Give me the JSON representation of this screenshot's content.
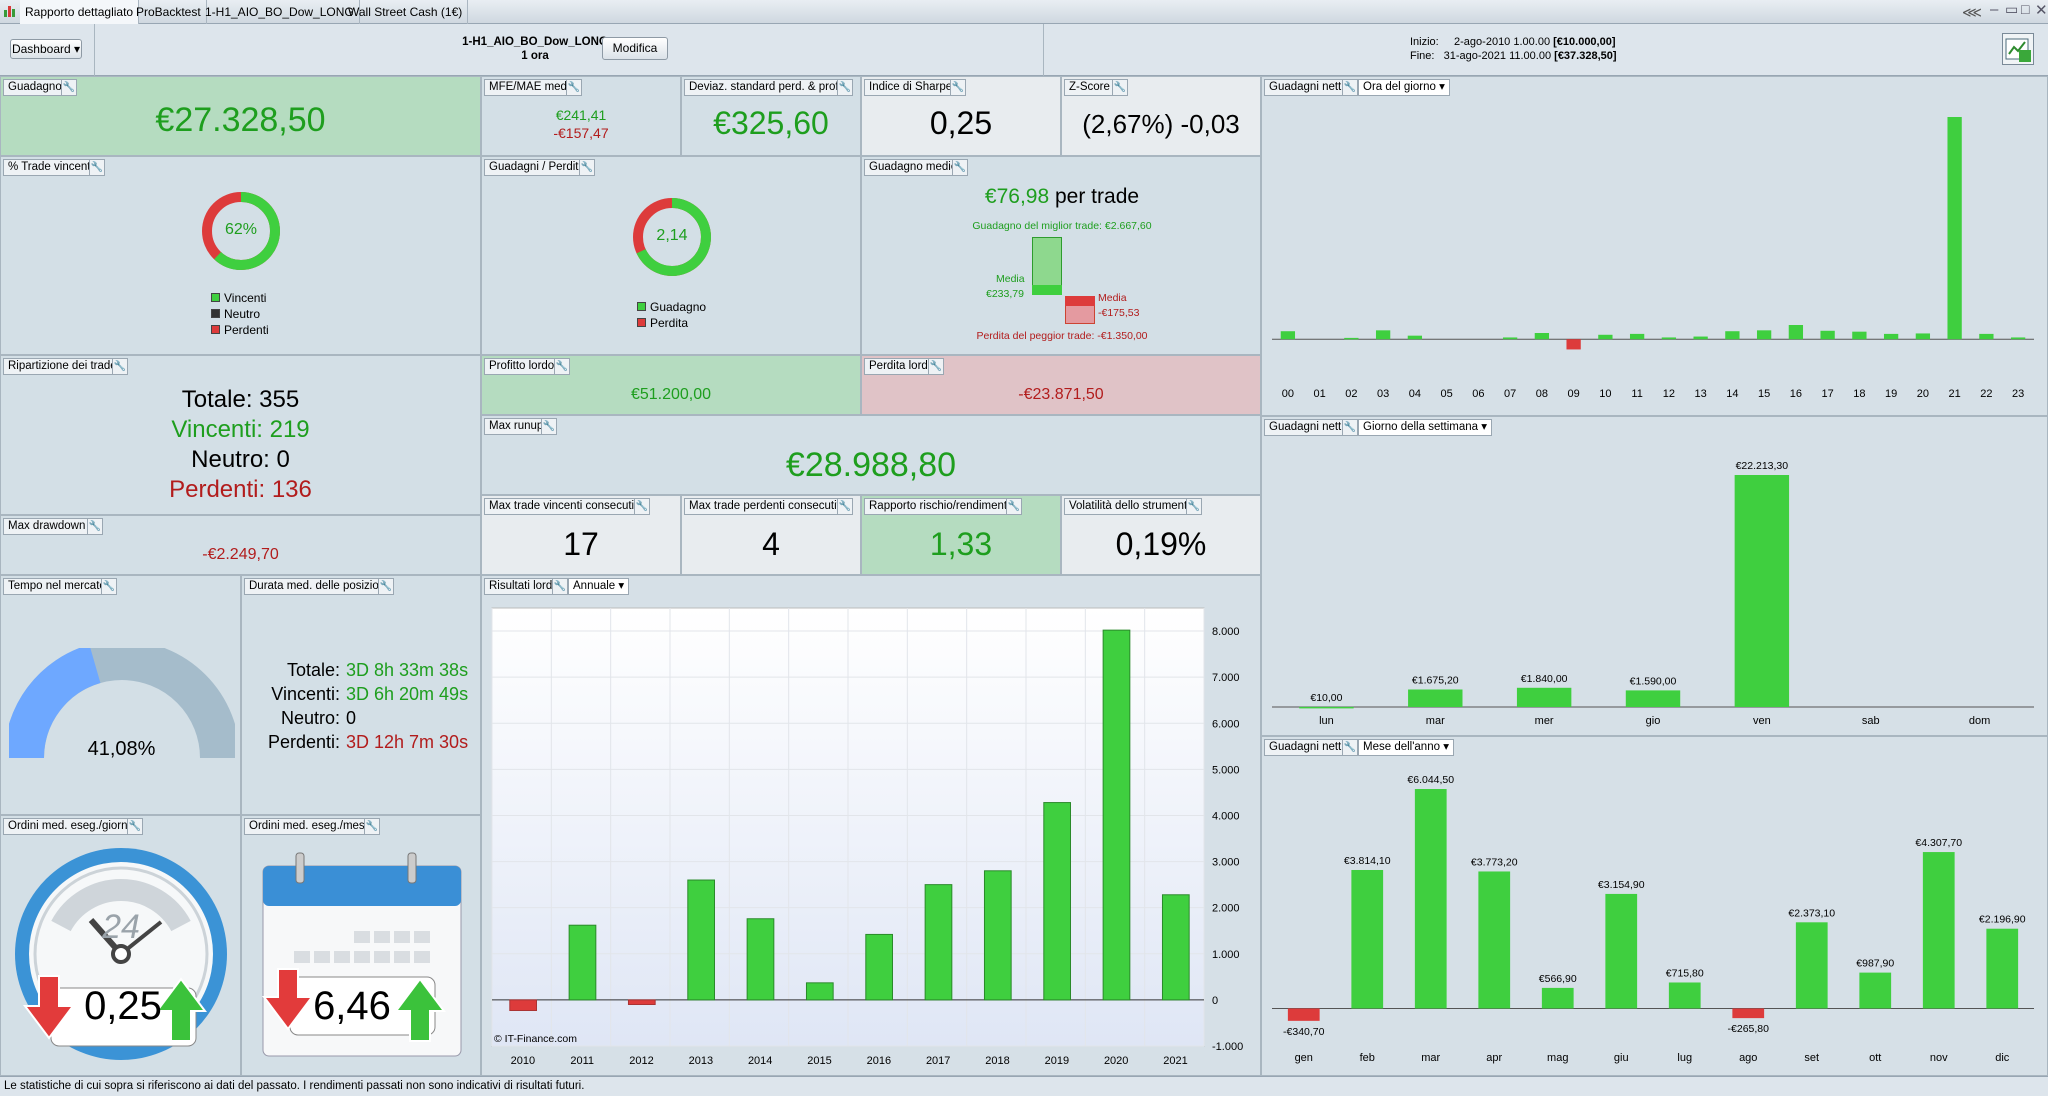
{
  "tabs": [
    "Rapporto dettagliato",
    "ProBacktest",
    "1-H1_AIO_BO_Dow_LONG",
    "Wall Street Cash (1€)"
  ],
  "header": {
    "dashboard_label": "Dashboard",
    "strategy_name": "1-H1_AIO_BO_Dow_LONG",
    "timeframe": "1 ora",
    "edit_label": "Modifica",
    "start_label": "Inizio:",
    "start_value": "2-ago-2010 1.00.00",
    "start_capital": "[€10.000,00]",
    "end_label": "Fine:",
    "end_value": "31-ago-2021 11.00.00",
    "end_capital": "[€37.328,50]"
  },
  "colors": {
    "green": "#3fcf3f",
    "red": "#dd3b3b",
    "text_green": "#1e9e1e",
    "text_red": "#b21c1c"
  },
  "icons": [
    "calendar-icon",
    "wrench-icon",
    "share-icon",
    "report-icon"
  ],
  "guadagno": {
    "title": "Guadagno",
    "value": "€27.328,50"
  },
  "mfe": {
    "title": "MFE/MAE medio",
    "mfe": "€241,41",
    "mae": "-€157,47"
  },
  "deviaz": {
    "title": "Deviaz. standard perd. & prof.",
    "value": "€325,60"
  },
  "sharpe": {
    "title": "Indice di Sharpe",
    "value": "0,25"
  },
  "zscore": {
    "title": "Z-Score",
    "value": "(2,67%) -0,03"
  },
  "win_pct": {
    "title": "% Trade vincenti",
    "value": "62%",
    "fraction": 0.62,
    "legend": [
      "Vincenti",
      "Neutro",
      "Perdenti"
    ]
  },
  "gain_loss": {
    "title": "Guadagni / Perdite",
    "value": "2,14",
    "fraction": 0.68,
    "legend": [
      "Guadagno",
      "Perdita"
    ]
  },
  "avg_gain": {
    "title": "Guadagno medio",
    "value": "€76,98",
    "suffix": "per trade",
    "best": "Guadagno del miglior trade: €2.667,60",
    "avg_win_label": "Media",
    "avg_win_value": "€233,79",
    "avg_loss_label": "Media",
    "avg_loss_value": "-€175,53",
    "worst": "Perdita del peggior trade: -€1.350,00"
  },
  "breakdown": {
    "title": "Ripartizione dei trade",
    "total": "Totale: 355",
    "winners": "Vincenti: 219",
    "neutral": "Neutro: 0",
    "losers": "Perdenti: 136"
  },
  "gross_profit": {
    "title": "Profitto lordo",
    "value": "€51.200,00"
  },
  "gross_loss": {
    "title": "Perdita lorda",
    "value": "-€23.871,50"
  },
  "max_runup": {
    "title": "Max runup",
    "value": "€28.988,80"
  },
  "max_drawdown": {
    "title": "Max drawdown",
    "value": "-€2.249,70"
  },
  "consec_win": {
    "title": "Max trade vincenti consecutivi",
    "value": "17"
  },
  "consec_loss": {
    "title": "Max trade perdenti consecutivi",
    "value": "4"
  },
  "risk_reward": {
    "title": "Rapporto rischio/rendimento",
    "value": "1,33"
  },
  "volatility": {
    "title": "Volatilità dello strumento",
    "value": "0,19%"
  },
  "time_market": {
    "title": "Tempo nel mercato",
    "value": "41,08%",
    "fraction": 0.4108
  },
  "duration": {
    "title": "Durata med. delle posizioni",
    "rows": [
      {
        "label": "Totale:",
        "value": "3D 8h 33m 38s"
      },
      {
        "label": "Vincenti:",
        "value": "3D 6h 20m 49s"
      },
      {
        "label": "Neutro:",
        "value": "0"
      },
      {
        "label": "Perdenti:",
        "value": "3D 12h 7m 30s"
      }
    ]
  },
  "orders_day": {
    "title": "Ordini med. eseg./giorno",
    "value": "0,25",
    "clock_label": "24"
  },
  "orders_month": {
    "title": "Ordini med. eseg./mese",
    "value": "6,46"
  },
  "gross_results": {
    "title": "Risultati lordi",
    "dropdown": "Annuale",
    "credit": "© IT-Finance.com"
  },
  "hourly": {
    "title": "Guadagni netti",
    "dropdown": "Ora del giorno"
  },
  "weekday": {
    "title": "Guadagni netti",
    "dropdown": "Giorno della settimana"
  },
  "monthly": {
    "title": "Guadagni netti",
    "dropdown": "Mese dell'anno"
  },
  "footer": "Le statistiche di cui sopra si riferiscono ai dati del passato. I rendimenti passati non sono indicativi di risultati futuri.",
  "chart_data": [
    {
      "type": "bar",
      "title": "Risultati lordi",
      "categories": [
        "2010",
        "2011",
        "2012",
        "2013",
        "2014",
        "2015",
        "2016",
        "2017",
        "2018",
        "2019",
        "2020",
        "2021"
      ],
      "values": [
        -230,
        1620,
        -100,
        2600,
        1760,
        370,
        1420,
        2500,
        2800,
        4280,
        8020,
        2280
      ],
      "ylim": [
        -1000,
        8500
      ],
      "yticks": [
        "8.000",
        "7.000",
        "6.000",
        "5.000",
        "4.000",
        "3.000",
        "2.000",
        "1.000",
        "0",
        "-1.000"
      ]
    },
    {
      "type": "bar",
      "title": "Ora del giorno",
      "categories": [
        "00",
        "01",
        "02",
        "03",
        "04",
        "05",
        "06",
        "07",
        "08",
        "09",
        "10",
        "11",
        "12",
        "13",
        "14",
        "15",
        "16",
        "17",
        "18",
        "19",
        "20",
        "21",
        "22",
        "23"
      ],
      "values": [
        180,
        0,
        30,
        200,
        80,
        0,
        0,
        40,
        140,
        -230,
        100,
        120,
        40,
        60,
        180,
        200,
        320,
        190,
        170,
        120,
        130,
        5000,
        120,
        40
      ],
      "ylim": [
        -400,
        5000
      ]
    },
    {
      "type": "bar",
      "title": "Giorno della settimana",
      "categories": [
        "lun",
        "mar",
        "mer",
        "gio",
        "ven",
        "sab",
        "dom"
      ],
      "values": [
        10.0,
        1675.2,
        1840.0,
        1590.0,
        22213.3,
        0,
        0
      ],
      "labels": [
        "€10,00",
        "€1.675,20",
        "€1.840,00",
        "€1.590,00",
        "€22.213,30",
        "",
        ""
      ],
      "ylim": [
        0,
        22213.3
      ]
    },
    {
      "type": "bar",
      "title": "Mese dell'anno",
      "categories": [
        "gen",
        "feb",
        "mar",
        "apr",
        "mag",
        "giu",
        "lug",
        "ago",
        "set",
        "ott",
        "nov",
        "dic"
      ],
      "values": [
        -340.7,
        3814.1,
        6044.5,
        3773.2,
        566.9,
        3154.9,
        715.8,
        -265.8,
        2373.1,
        987.9,
        4307.7,
        2196.9
      ],
      "labels": [
        "-€340,70",
        "€3.814,10",
        "€6.044,50",
        "€3.773,20",
        "€566,90",
        "€3.154,90",
        "€715,80",
        "-€265,80",
        "€2.373,10",
        "€987,90",
        "€4.307,70",
        "€2.196,90"
      ],
      "ylim": [
        -400,
        6044.5
      ]
    }
  ]
}
